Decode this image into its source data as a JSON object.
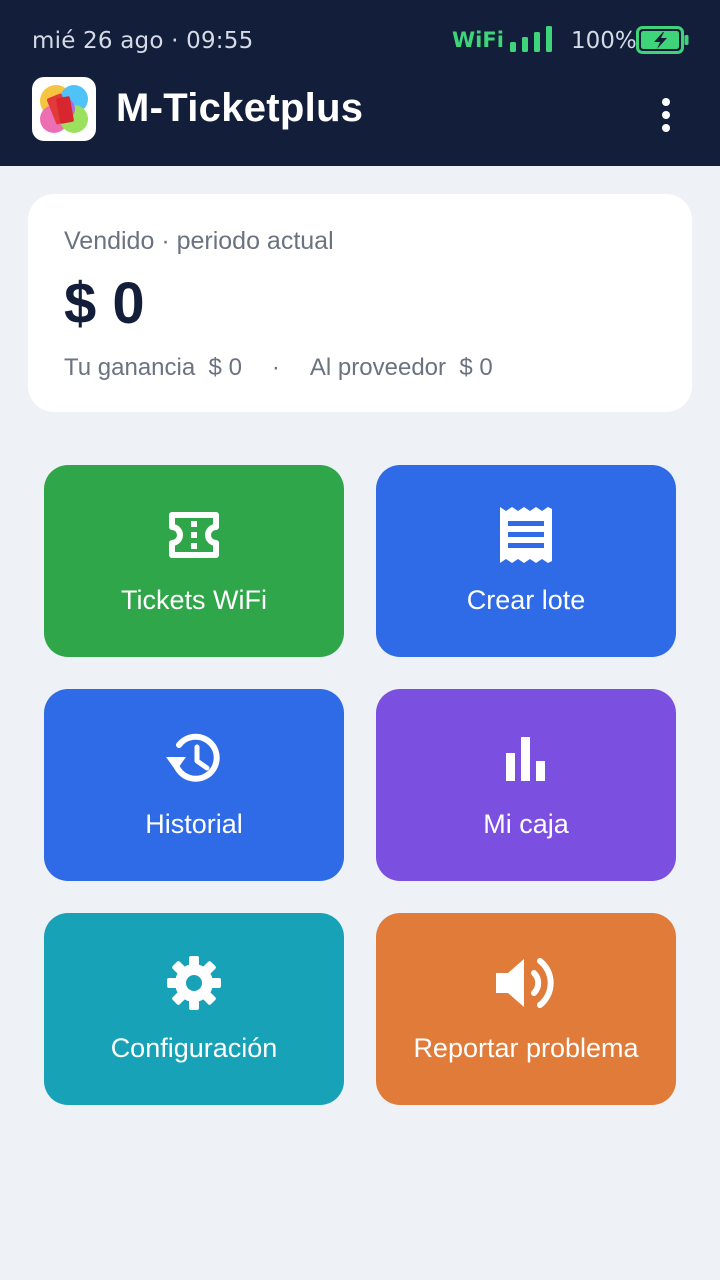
{
  "status_bar": {
    "datetime": "mié 26 ago  ·  09:55",
    "network_label": "WiFi",
    "battery_percent": "100%",
    "network_color": "#3fd47a",
    "icons": [
      "signal-bars-icon",
      "battery-charging-icon"
    ]
  },
  "app_bar": {
    "title": "M-Ticketplus",
    "icons": [
      "app-logo",
      "more-vertical-icon"
    ],
    "background": "#131f3a"
  },
  "summary": {
    "label": "Vendido · periodo actual",
    "total": "$ 0",
    "earnings_label": "Tu ganancia",
    "earnings_value": "$ 0",
    "separator": "·",
    "provider_label": "Al proveedor",
    "provider_value": "$ 0"
  },
  "tiles": [
    {
      "label": "Tickets WiFi",
      "icon": "ticket-icon",
      "color": "#30a64a"
    },
    {
      "label": "Crear lote",
      "icon": "receipt-icon",
      "color": "#2f6be6"
    },
    {
      "label": "Historial",
      "icon": "history-icon",
      "color": "#2f6be6"
    },
    {
      "label": "Mi caja",
      "icon": "bar-chart-icon",
      "color": "#7b4fe0"
    },
    {
      "label": "Configuración",
      "icon": "gear-icon",
      "color": "#17a2b8"
    },
    {
      "label": "Reportar problema",
      "icon": "speaker-icon",
      "color": "#e07b39"
    }
  ]
}
